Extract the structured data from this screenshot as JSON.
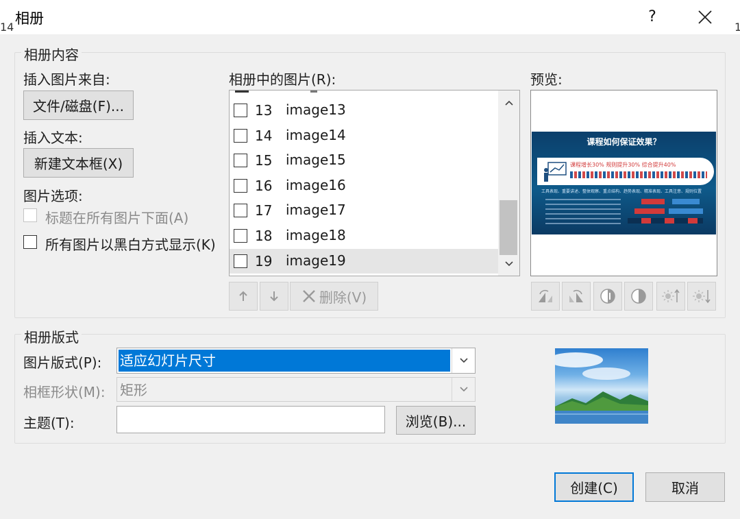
{
  "window": {
    "title": "相册",
    "help_label": "?",
    "close_label": "✕",
    "left_edge_text": "14",
    "right_edge_text": "1"
  },
  "content_group": {
    "label": "相册内容",
    "insert_picture_from": "插入图片来自:",
    "file_disk_button": "文件/磁盘(F)...",
    "insert_text": "插入文本:",
    "new_textbox_button": "新建文本框(X)",
    "picture_options": "图片选项:",
    "caption_below_all": "标题在所有图片下面(A)",
    "all_black_white": "所有图片以黑白方式显示(K)",
    "pictures_in_album_label": "相册中的图片(R):",
    "preview_label": "预览:",
    "pictures": [
      {
        "num": "13",
        "name": "image13"
      },
      {
        "num": "14",
        "name": "image14"
      },
      {
        "num": "15",
        "name": "image15"
      },
      {
        "num": "16",
        "name": "image16"
      },
      {
        "num": "17",
        "name": "image17"
      },
      {
        "num": "18",
        "name": "image18"
      },
      {
        "num": "19",
        "name": "image19",
        "selected": true
      }
    ],
    "move_up_icon": "arrow-up-icon",
    "move_down_icon": "arrow-down-icon",
    "delete_button": "删除(V)"
  },
  "preview_slide": {
    "title": "课程如何保证效果？",
    "stat_text": "课程增长30%  规则提升30%  综合提升40%",
    "row_text": "工具表现、重要讲述、整体观察、重点结构、趋势表现、精准表现、工具注意、规则位置"
  },
  "layout_group": {
    "label": "相册版式",
    "picture_layout_label": "图片版式(P):",
    "picture_layout_value": "适应幻灯片尺寸",
    "frame_shape_label": "相框形状(M):",
    "frame_shape_value": "矩形",
    "theme_label": "主题(T):",
    "theme_value": "",
    "browse_button": "浏览(B)..."
  },
  "footer": {
    "create_button": "创建(C)",
    "cancel_button": "取消"
  },
  "colors": {
    "accent": "#0078d7",
    "selection_bg": "#0078d7"
  }
}
